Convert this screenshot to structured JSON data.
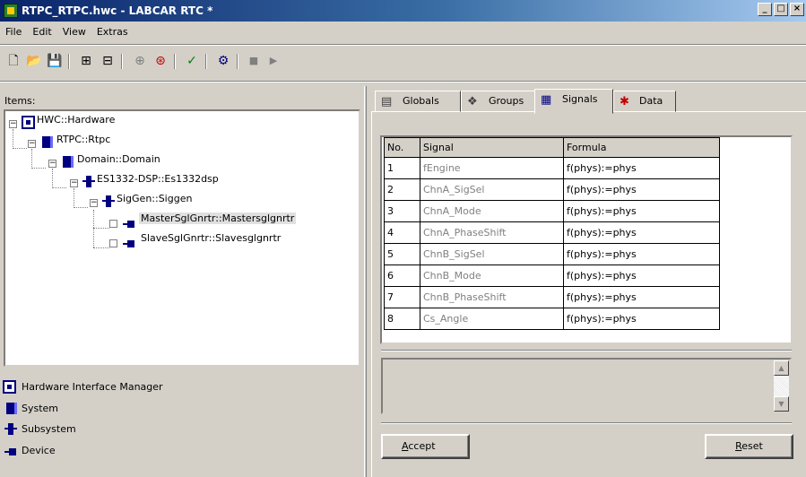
{
  "window": {
    "title": "RTPC_RTPC.hwc - LABCAR RTC  *",
    "minimize": "_",
    "maximize": "□",
    "close": "×"
  },
  "menu": [
    "File",
    "Edit",
    "View",
    "Extras"
  ],
  "toolbar": {
    "buttons": [
      {
        "name": "new-icon",
        "glyph": "🗋"
      },
      {
        "name": "open-folder-icon",
        "glyph": "📂"
      },
      {
        "name": "save-icon",
        "glyph": "💾"
      },
      {
        "name": "hardware-tree-icon",
        "glyph": "⊞"
      },
      {
        "name": "hardware-tree-alt-icon",
        "glyph": "⊟"
      },
      {
        "name": "add-subsystem-icon",
        "glyph": "⊕"
      },
      {
        "name": "add-device-icon",
        "glyph": "⊛"
      },
      {
        "name": "check-icon",
        "glyph": "✓"
      },
      {
        "name": "connect-icon",
        "glyph": "⚙"
      },
      {
        "name": "stop-icon",
        "glyph": "■"
      },
      {
        "name": "play-icon",
        "glyph": "▶"
      }
    ]
  },
  "left": {
    "items_label": "Items:",
    "tree": [
      {
        "label": "HWC::Hardware",
        "icon": "hardware"
      },
      {
        "label": "RTPC::Rtpc",
        "icon": "system"
      },
      {
        "label": "Domain::Domain",
        "icon": "system"
      },
      {
        "label": "ES1332-DSP::Es1332dsp",
        "icon": "subsystem"
      },
      {
        "label": "SigGen::Siggen",
        "icon": "subsystem"
      },
      {
        "label": "MasterSglGnrtr::Mastersglgnrtr",
        "icon": "device",
        "selected": true
      },
      {
        "label": "SlaveSglGnrtr::Slavesglgnrtr",
        "icon": "device"
      }
    ],
    "legend": [
      {
        "label": "Hardware Interface Manager",
        "icon": "hardware"
      },
      {
        "label": "System",
        "icon": "system"
      },
      {
        "label": "Subsystem",
        "icon": "subsystem"
      },
      {
        "label": "Device",
        "icon": "device"
      }
    ]
  },
  "tabs": [
    {
      "label": "Globals",
      "icon": "globals-icon"
    },
    {
      "label": "Groups",
      "icon": "groups-icon"
    },
    {
      "label": "Signals",
      "icon": "signals-icon",
      "active": true
    },
    {
      "label": "Data",
      "icon": "data-icon"
    }
  ],
  "signals_table": {
    "headers": [
      "No.",
      "Signal",
      "Formula"
    ],
    "rows": [
      [
        "1",
        "fEngine",
        "f(phys):=phys"
      ],
      [
        "2",
        "ChnA_SigSel",
        "f(phys):=phys"
      ],
      [
        "3",
        "ChnA_Mode",
        "f(phys):=phys"
      ],
      [
        "4",
        "ChnA_PhaseShift",
        "f(phys):=phys"
      ],
      [
        "5",
        "ChnB_SigSel",
        "f(phys):=phys"
      ],
      [
        "6",
        "ChnB_Mode",
        "f(phys):=phys"
      ],
      [
        "7",
        "ChnB_PhaseShift",
        "f(phys):=phys"
      ],
      [
        "8",
        "Cs_Angle",
        "f(phys):=phys"
      ]
    ]
  },
  "buttons": {
    "accept": {
      "mnemonic": "A",
      "rest": "ccept"
    },
    "reset": {
      "mnemonic": "R",
      "rest": "eset"
    }
  }
}
